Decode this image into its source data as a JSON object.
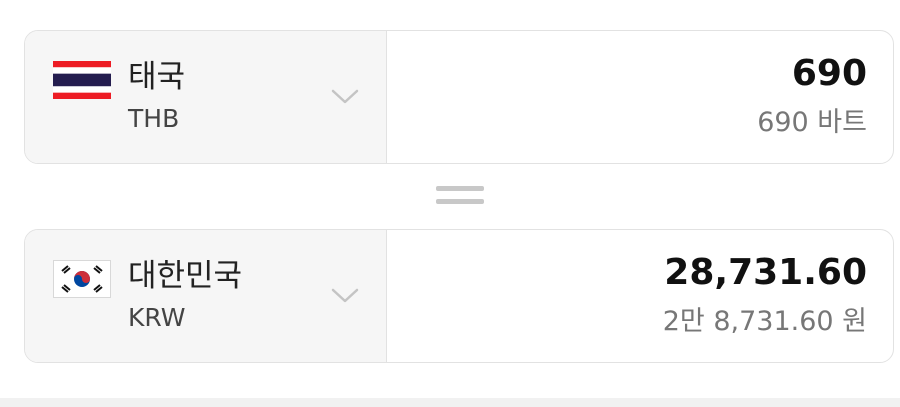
{
  "from": {
    "country_name": "태국",
    "currency_code": "THB",
    "amount": "690",
    "amount_text": "690 바트",
    "flag_icon": "thailand-flag-icon"
  },
  "to": {
    "country_name": "대한민국",
    "currency_code": "KRW",
    "amount": "28,731.60",
    "amount_text": "2만 8,731.60 원",
    "flag_icon": "south-korea-flag-icon"
  },
  "equals_icon": "equals-icon",
  "dropdown_icon": "chevron-down-icon",
  "colors": {
    "thai_red": "#ED1C24",
    "thai_blue": "#241D4F",
    "korea_red": "#CD2E3A",
    "korea_blue": "#0047A0"
  }
}
